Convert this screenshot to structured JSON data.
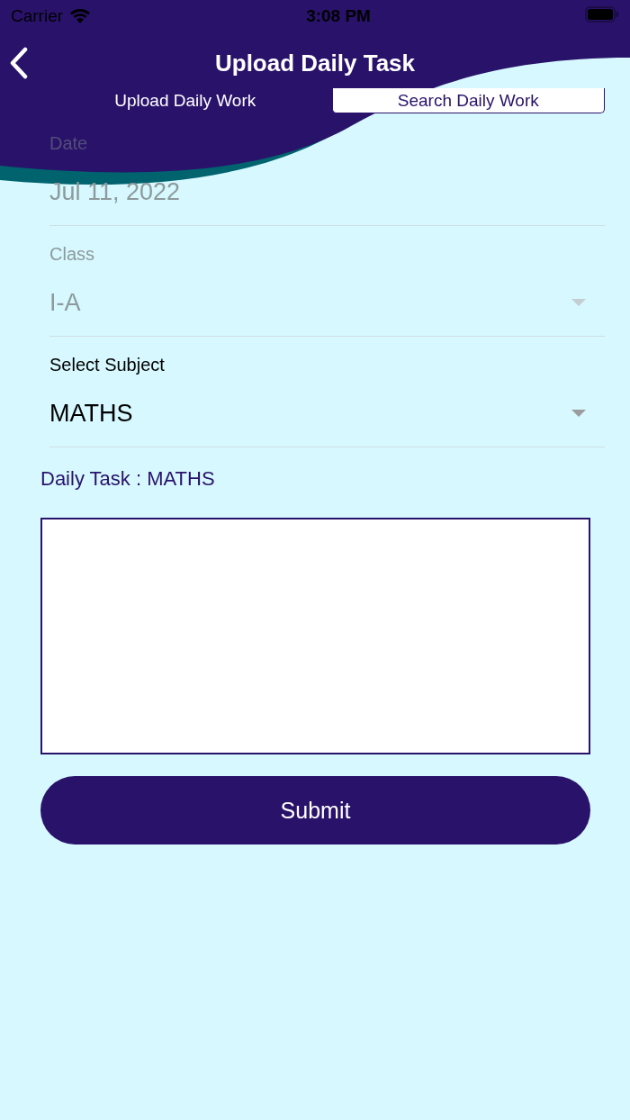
{
  "status_bar": {
    "carrier": "Carrier",
    "time": "3:08 PM"
  },
  "nav_bar": {
    "title": "Upload Daily Task"
  },
  "tabs": [
    {
      "label": "Upload Daily Work",
      "selected": true
    },
    {
      "label": "Search Daily Work",
      "selected": false
    }
  ],
  "form": {
    "fields": [
      {
        "kind": "text",
        "label": "Date",
        "value": "Jul 11, 2022",
        "disabled": true
      },
      {
        "kind": "dropdown",
        "label": "Class",
        "value": "I-A",
        "disabled": true
      },
      {
        "kind": "dropdown",
        "label": "Select Subject",
        "value": "MATHS",
        "disabled": false
      }
    ],
    "task_label": "Daily Task : MATHS",
    "submit": "Submit"
  }
}
